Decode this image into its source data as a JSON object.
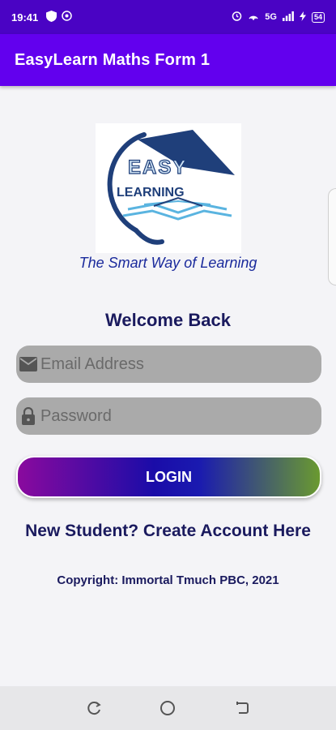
{
  "status_bar": {
    "time": "19:41",
    "battery_level": "54",
    "signal_text": "5G"
  },
  "app_bar": {
    "title": "EasyLearn Maths Form 1"
  },
  "logo": {
    "word_top": "EASY",
    "word_bottom": "LEARNING",
    "colors": {
      "navy": "#1f3f7a",
      "light_blue": "#5ab4e0"
    }
  },
  "tagline": "The Smart Way of Learning",
  "welcome": "Welcome Back",
  "email": {
    "placeholder": "Email Address",
    "icon": "mail-icon"
  },
  "password": {
    "placeholder": "Password",
    "icon": "lock-icon"
  },
  "login_button": {
    "label": "LOGIN"
  },
  "create_account": "New Student? Create Account Here",
  "copyright": "Copyright: Immortal Tmuch PBC, 2021",
  "colors": {
    "status_bar": "#4a03c4",
    "app_bar": "#6200ee",
    "text_dark": "#1a1a5e",
    "tagline": "#1a2a9c"
  }
}
